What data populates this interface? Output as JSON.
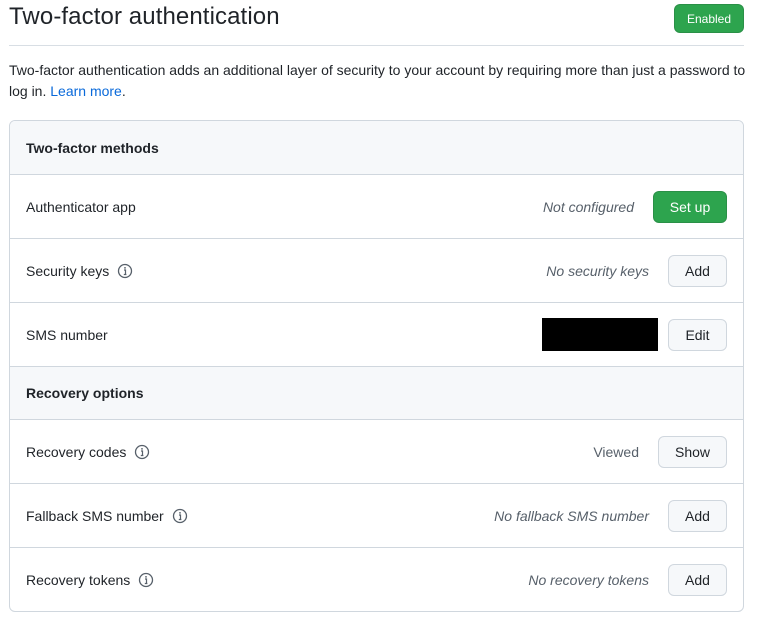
{
  "header": {
    "title": "Two-factor authentication",
    "status_badge": "Enabled"
  },
  "description": {
    "text": "Two-factor authentication adds an additional layer of security to your account by requiring more than just a password to log in.",
    "link_label": "Learn more",
    "trailing": "."
  },
  "methods": {
    "heading": "Two-factor methods",
    "authenticator": {
      "label": "Authenticator app",
      "status": "Not configured",
      "button": "Set up"
    },
    "security_keys": {
      "label": "Security keys",
      "status": "No security keys",
      "button": "Add"
    },
    "sms": {
      "label": "SMS number",
      "button": "Edit"
    }
  },
  "recovery": {
    "heading": "Recovery options",
    "codes": {
      "label": "Recovery codes",
      "status": "Viewed",
      "button": "Show"
    },
    "fallback_sms": {
      "label": "Fallback SMS number",
      "status": "No fallback SMS number",
      "button": "Add"
    },
    "tokens": {
      "label": "Recovery tokens",
      "status": "No recovery tokens",
      "button": "Add"
    }
  },
  "colors": {
    "primary_green": "#2da44e",
    "link_blue": "#0969da",
    "border": "#d0d7de",
    "header_bg": "#f6f8fa"
  },
  "icons": {
    "info": "info-icon"
  }
}
